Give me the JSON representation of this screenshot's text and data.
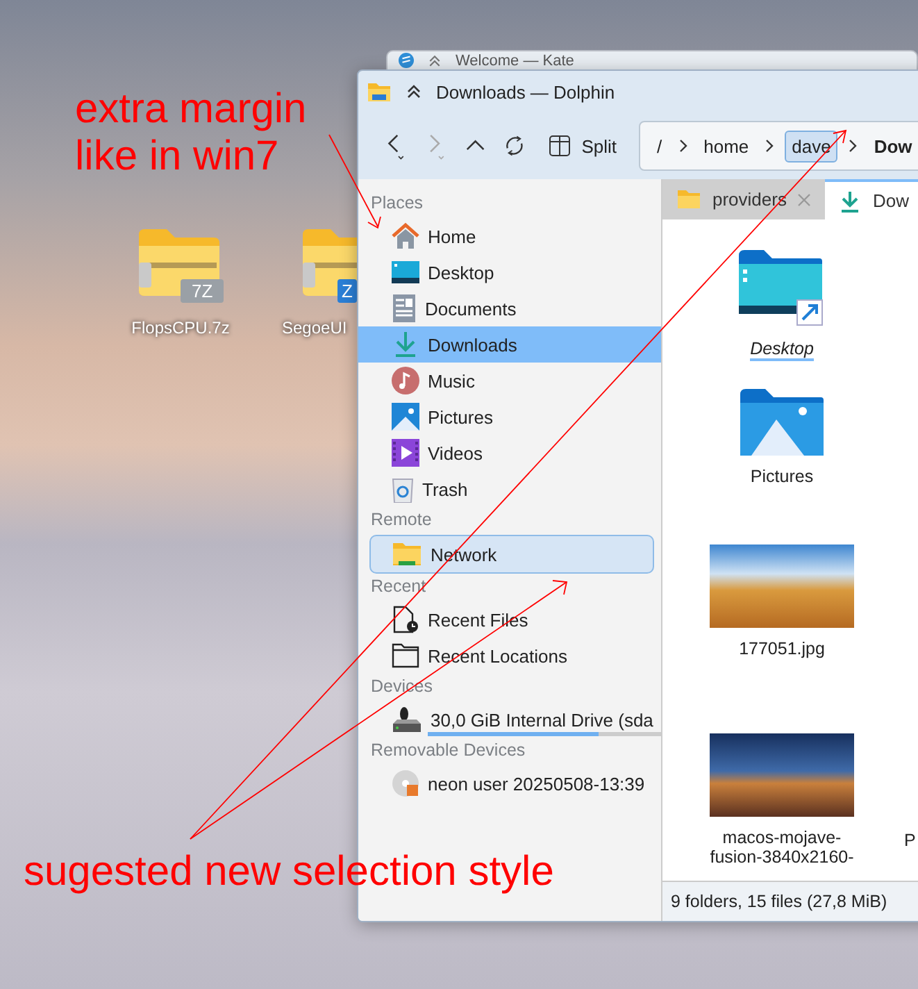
{
  "desktop_icons": [
    {
      "label": "FlopsCPU.7z",
      "badge": "7Z"
    },
    {
      "label": "SegoeUI",
      "badge": "Z"
    }
  ],
  "background_window": {
    "title": "Welcome — Kate"
  },
  "window": {
    "title": "Downloads — Dolphin"
  },
  "toolbar": {
    "split_label": "Split",
    "forward_disabled": true,
    "breadcrumb": [
      {
        "label": "/",
        "selected": false
      },
      {
        "label": "home",
        "selected": false
      },
      {
        "label": "dave",
        "selected": true
      },
      {
        "label": "Dow",
        "selected": false
      }
    ]
  },
  "sidebar": {
    "sections": [
      {
        "title": "Places",
        "items": [
          {
            "kind": "home",
            "label": "Home",
            "selected": false
          },
          {
            "kind": "desktop",
            "label": "Desktop",
            "selected": false
          },
          {
            "kind": "documents",
            "label": "Documents",
            "selected": false
          },
          {
            "kind": "downloads",
            "label": "Downloads",
            "selected": true,
            "rounded_selection": false
          },
          {
            "kind": "music",
            "label": "Music",
            "selected": false
          },
          {
            "kind": "pictures",
            "label": "Pictures",
            "selected": false
          },
          {
            "kind": "videos",
            "label": "Videos",
            "selected": false
          },
          {
            "kind": "trash",
            "label": "Trash",
            "selected": false
          }
        ]
      },
      {
        "title": "Remote",
        "items": [
          {
            "kind": "network",
            "label": "Network",
            "selected": true,
            "rounded_selection": true
          }
        ]
      },
      {
        "title": "Recent",
        "items": [
          {
            "kind": "recent-files",
            "label": "Recent Files",
            "selected": false
          },
          {
            "kind": "recent-locations",
            "label": "Recent Locations",
            "selected": false
          }
        ]
      },
      {
        "title": "Devices",
        "items": [
          {
            "kind": "drive",
            "label": "30,0 GiB Internal Drive (sda",
            "selected": false,
            "level": 0.73
          }
        ]
      },
      {
        "title": "Removable Devices",
        "items": [
          {
            "kind": "disc",
            "label": "neon user 20250508-13:39",
            "selected": false
          }
        ]
      }
    ]
  },
  "tabs": [
    {
      "label": "providers",
      "selected": false
    },
    {
      "label": "Dow",
      "selected": true
    }
  ],
  "files": [
    {
      "kind": "desktop-link",
      "label": "Desktop"
    },
    {
      "kind": "folder-pictures",
      "label": "Pictures"
    },
    {
      "kind": "image-dunes",
      "label": "177051.jpg"
    },
    {
      "kind": "image-mojave",
      "label": "macos-mojave-fusion-3840x2160-"
    }
  ],
  "partial_file": {
    "label": "P"
  },
  "status_bar": {
    "text": "9 folders, 15 files (27,8 MiB)"
  },
  "annotations": [
    {
      "text": "extra margin\nlike in win7"
    },
    {
      "text": "sugested new selection style"
    }
  ]
}
